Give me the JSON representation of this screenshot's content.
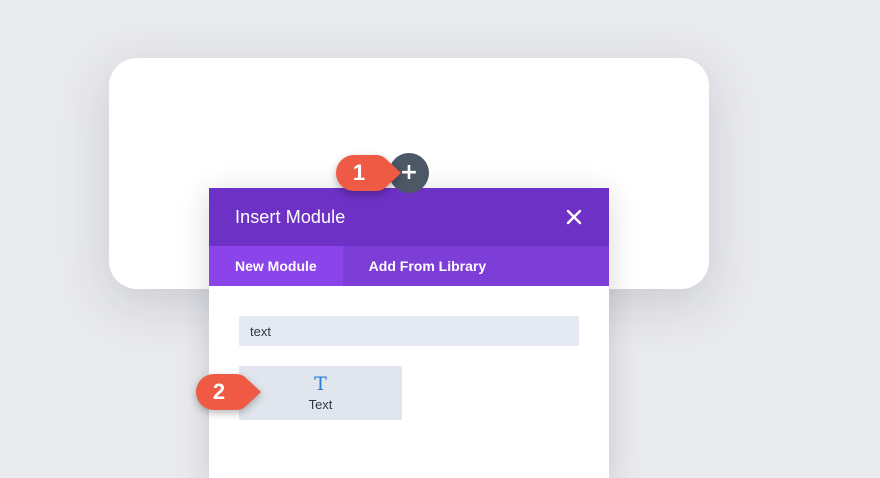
{
  "builder": {
    "add_module_icon": "plus-icon"
  },
  "modal": {
    "title": "Insert Module",
    "close_icon": "close-icon",
    "tabs": [
      {
        "label": "New Module",
        "active": true
      },
      {
        "label": "Add From Library",
        "active": false
      }
    ],
    "search": {
      "value": "text",
      "placeholder": ""
    },
    "modules": [
      {
        "label": "Text",
        "icon": "T",
        "icon_name": "text-module-icon"
      }
    ]
  },
  "callouts": [
    {
      "number": "1"
    },
    {
      "number": "2"
    }
  ],
  "colors": {
    "page_background": "#e9eaee",
    "header": "#6d31c5",
    "tabs_bar": "#7d3ed7",
    "active_tab": "#8b44ea",
    "add_button": "#4c5866",
    "callout": "#ee5a43",
    "module_icon": "#2a7ed8"
  }
}
